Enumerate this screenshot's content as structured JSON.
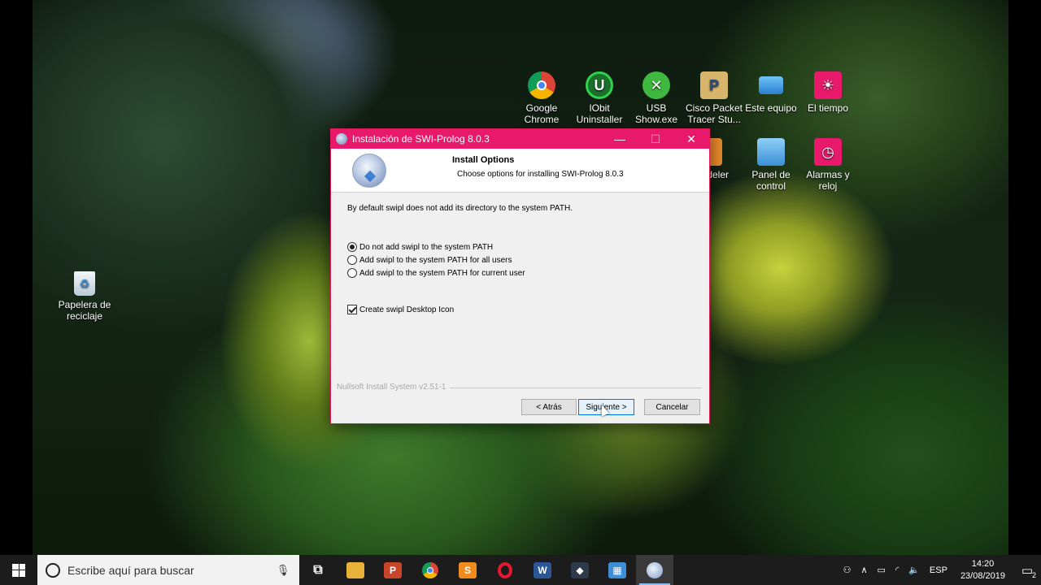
{
  "desktop": {
    "icons": [
      {
        "label": "Google Chrome",
        "icon": "chrome-icon"
      },
      {
        "label": "IObit Uninstaller",
        "icon": "iobit-icon"
      },
      {
        "label": "USB Show.exe",
        "icon": "usb-show-icon"
      },
      {
        "label": "Cisco Packet Tracer Stu...",
        "icon": "packet-tracer-icon"
      },
      {
        "label": "Este equipo",
        "icon": "computer-icon"
      },
      {
        "label": "El tiempo",
        "icon": "weather-icon"
      },
      {
        "label": "zagi deler",
        "icon": "modeler-icon"
      },
      {
        "label": "Panel de control",
        "icon": "control-panel-icon"
      },
      {
        "label": "Alarmas y reloj",
        "icon": "alarm-clock-icon"
      },
      {
        "label": "Papelera de reciclaje",
        "icon": "recycle-bin-icon"
      }
    ]
  },
  "installer": {
    "title": "Instalación de SWI-Prolog 8.0.3",
    "header_title": "Install Options",
    "header_subtitle": "Choose options for installing SWI-Prolog 8.0.3",
    "intro": "By default swipl does not add its directory to the system PATH.",
    "options": [
      {
        "label": "Do not add swipl to the system PATH",
        "selected": true
      },
      {
        "label": "Add swipl to the system PATH for all users",
        "selected": false
      },
      {
        "label": "Add swipl to the system PATH for current user",
        "selected": false
      }
    ],
    "desktop_icon_label": "Create swipl Desktop Icon",
    "desktop_icon_checked": true,
    "branding": "Nullsoft Install System v2.51-1",
    "buttons": {
      "back": "< Atrás",
      "next": "Siguiente >",
      "cancel": "Cancelar"
    },
    "controls": {
      "minimize": "—",
      "maximize": "☐",
      "close": "✕"
    }
  },
  "taskbar": {
    "search_placeholder": "Escribe aquí para buscar",
    "apps": [
      {
        "name": "task-view",
        "glyph": "⧉",
        "color": "#1c1c1c"
      },
      {
        "name": "file-explorer",
        "glyph": "▬",
        "color": "#e8b23a"
      },
      {
        "name": "powerpoint",
        "glyph": "P",
        "color": "#c9452a"
      },
      {
        "name": "chrome",
        "glyph": "●",
        "color": "#3b8c3e"
      },
      {
        "name": "sublime-text",
        "glyph": "S",
        "color": "#f08c1d"
      },
      {
        "name": "opera",
        "glyph": "O",
        "color": "#cf1a2a"
      },
      {
        "name": "word",
        "glyph": "W",
        "color": "#2b5797"
      },
      {
        "name": "app-dark",
        "glyph": "◆",
        "color": "#2d3a4a"
      },
      {
        "name": "app-blue",
        "glyph": "▦",
        "color": "#3d8ed6"
      },
      {
        "name": "swi-prolog",
        "glyph": "◉",
        "color": "#8aa6cf"
      }
    ],
    "language": "ESP",
    "time": "14:20",
    "date": "23/08/2019",
    "notifications": "2"
  }
}
